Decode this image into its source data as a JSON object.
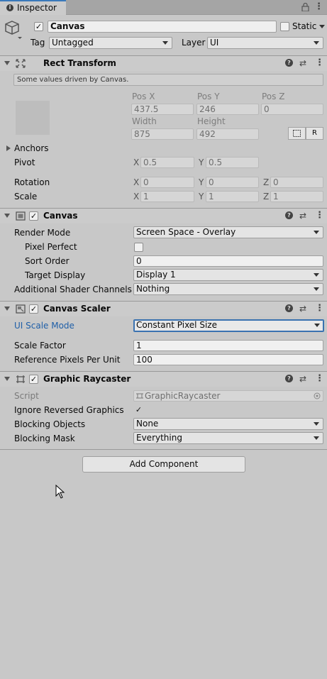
{
  "tab": {
    "title": "Inspector"
  },
  "gameobject": {
    "name": "Canvas",
    "static_label": "Static",
    "tag_label": "Tag",
    "tag_value": "Untagged",
    "layer_label": "Layer",
    "layer_value": "UI",
    "active": true
  },
  "rect_transform": {
    "title": "Rect Transform",
    "info": "Some values driven by Canvas.",
    "pos_x_label": "Pos X",
    "pos_y_label": "Pos Y",
    "pos_z_label": "Pos Z",
    "pos_x": "437.5",
    "pos_y": "246",
    "pos_z": "0",
    "width_label": "Width",
    "height_label": "Height",
    "width": "875",
    "height": "492",
    "r_button": "R",
    "anchors_label": "Anchors",
    "pivot_label": "Pivot",
    "pivot_x": "0.5",
    "pivot_y": "0.5",
    "rotation_label": "Rotation",
    "rot_x": "0",
    "rot_y": "0",
    "rot_z": "0",
    "scale_label": "Scale",
    "scale_x": "1",
    "scale_y": "1",
    "scale_z": "1",
    "axis_x": "X",
    "axis_y": "Y",
    "axis_z": "Z"
  },
  "canvas": {
    "title": "Canvas",
    "render_mode_label": "Render Mode",
    "render_mode": "Screen Space - Overlay",
    "pixel_perfect_label": "Pixel Perfect",
    "sort_order_label": "Sort Order",
    "sort_order": "0",
    "target_display_label": "Target Display",
    "target_display": "Display 1",
    "shader_channels_label": "Additional Shader Channels",
    "shader_channels": "Nothing"
  },
  "canvas_scaler": {
    "title": "Canvas Scaler",
    "ui_scale_mode_label": "UI Scale Mode",
    "ui_scale_mode": "Constant Pixel Size",
    "scale_factor_label": "Scale Factor",
    "scale_factor": "1",
    "ref_ppu_label": "Reference Pixels Per Unit",
    "ref_ppu": "100"
  },
  "graphic_raycaster": {
    "title": "Graphic Raycaster",
    "script_label": "Script",
    "script": "GraphicRaycaster",
    "ignore_reversed_label": "Ignore Reversed Graphics",
    "blocking_objects_label": "Blocking Objects",
    "blocking_objects": "None",
    "blocking_mask_label": "Blocking Mask",
    "blocking_mask": "Everything"
  },
  "add_component": "Add Component",
  "glyphs": {
    "check": "✓",
    "info": "i",
    "help": "?",
    "lock": "🔒",
    "kebab": "⋮",
    "preset": "⇄"
  },
  "colors": {
    "accent": "#3a79bb",
    "link_blue": "#1f5fa8"
  }
}
